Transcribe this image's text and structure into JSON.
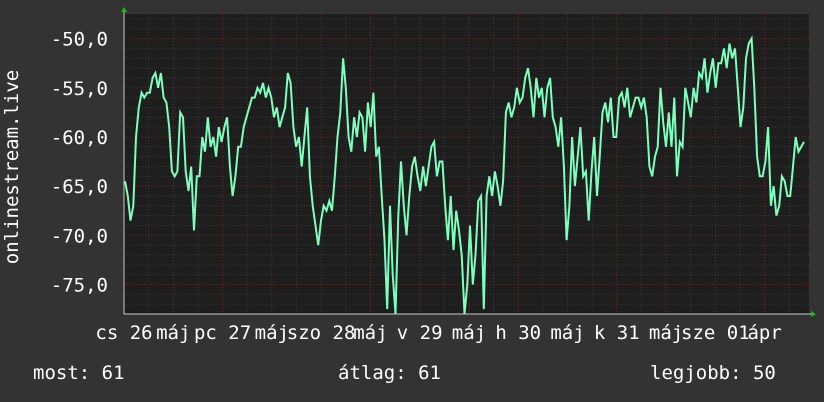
{
  "colors": {
    "background": "#333333",
    "plot_background": "#1e1e1e",
    "minor_grid": "#3a3a3a",
    "major_grid": "#6e2a2a",
    "line": "#7dffbe",
    "text": "#ffffff",
    "axis_arrow": "#00cc00"
  },
  "stats": {
    "current": "most: 61",
    "average": "átlag: 61",
    "best": "legjobb: 50"
  },
  "chart_data": {
    "type": "line",
    "ylabel": "onlinestream.live",
    "ylim": [
      -78,
      -47.5
    ],
    "y_ticks": [
      -50,
      -55,
      -60,
      -65,
      -70,
      -75
    ],
    "y_tick_labels": [
      "-50,0",
      "-55,0",
      "-60,0",
      "-65,0",
      "-70,0",
      "-75,0"
    ],
    "xlim": [
      0,
      6.95
    ],
    "x_tick_positions": [
      0,
      0.5,
      1,
      1.5,
      2,
      2.5,
      3,
      3.5,
      4,
      4.5,
      5,
      5.5,
      6,
      6.5
    ],
    "x_tick_labels": [
      "cs 26",
      "máj",
      "pc 27",
      "máj",
      "szo 28",
      "máj",
      "v 29",
      "máj",
      "h 30",
      "máj",
      "k 31",
      "máj",
      "sze 01",
      "ápr"
    ],
    "grid": true,
    "series": [
      {
        "values": [
          -64.5,
          -66,
          -68.5,
          -67,
          -60,
          -57,
          -55.5,
          -56,
          -55.5,
          -55.5,
          -54,
          -53.5,
          -55,
          -53.5,
          -56,
          -56.5,
          -59,
          -63.5,
          -64,
          -63.5,
          -57.5,
          -58,
          -63.5,
          -65.5,
          -63,
          -69.5,
          -64,
          -64,
          -60,
          -61.5,
          -58,
          -61,
          -60,
          -62,
          -59,
          -60.5,
          -59,
          -58,
          -63,
          -66,
          -64,
          -61,
          -61,
          -59,
          -58,
          -57,
          -56,
          -56,
          -55,
          -55.5,
          -54.5,
          -56,
          -55,
          -56,
          -58,
          -57,
          -59,
          -58,
          -57,
          -53.5,
          -54.5,
          -59,
          -61,
          -60,
          -63,
          -60,
          -57,
          -64,
          -67,
          -69,
          -71,
          -68.5,
          -67,
          -67.5,
          -66.5,
          -67.5,
          -64,
          -60,
          -57.5,
          -52,
          -55,
          -60,
          -61.5,
          -58,
          -60,
          -57.5,
          -58,
          -61.5,
          -56.5,
          -59,
          -55.5,
          -62,
          -61,
          -66,
          -70.5,
          -77.5,
          -67,
          -74,
          -78,
          -68,
          -62.5,
          -67,
          -70,
          -66,
          -63,
          -62,
          -64,
          -65.5,
          -63,
          -65,
          -63,
          -61,
          -60.5,
          -64,
          -62.5,
          -62.5,
          -67,
          -70.5,
          -66,
          -71.5,
          -67.5,
          -69.5,
          -72,
          -78,
          -75,
          -69,
          -75,
          -72,
          -66.5,
          -66,
          -77.5,
          -66,
          -64,
          -66,
          -63.5,
          -65,
          -67,
          -64.5,
          -57.5,
          -56.5,
          -58,
          -57,
          -55,
          -56.5,
          -56,
          -54,
          -53,
          -55,
          -58,
          -54,
          -56,
          -55,
          -58,
          -55,
          -54,
          -58,
          -59,
          -61,
          -58,
          -63,
          -70.5,
          -67,
          -60,
          -65,
          -62,
          -59,
          -64,
          -63.5,
          -68.5,
          -63.5,
          -60,
          -66,
          -62,
          -57.5,
          -56.5,
          -58.5,
          -56,
          -60,
          -60,
          -56,
          -55.5,
          -57,
          -55,
          -58,
          -57,
          -56,
          -56,
          -57,
          -56,
          -58,
          -63,
          -64,
          -62,
          -61,
          -55,
          -58.5,
          -61,
          -57.5,
          -61,
          -56,
          -64,
          -60.5,
          -61,
          -55,
          -56.5,
          -58,
          -55,
          -56.5,
          -53.5,
          -54,
          -52,
          -55.5,
          -53.5,
          -52,
          -55,
          -52.5,
          -52.5,
          -51,
          -53,
          -50.5,
          -52,
          -51,
          -55,
          -59,
          -57,
          -52,
          -50.5,
          -50,
          -55,
          -62,
          -64,
          -64,
          -62.5,
          -59,
          -67,
          -65,
          -68,
          -67,
          -64,
          -64.5,
          -66,
          -66,
          -63,
          -60,
          -61.5,
          -61,
          -60.5
        ]
      }
    ]
  }
}
